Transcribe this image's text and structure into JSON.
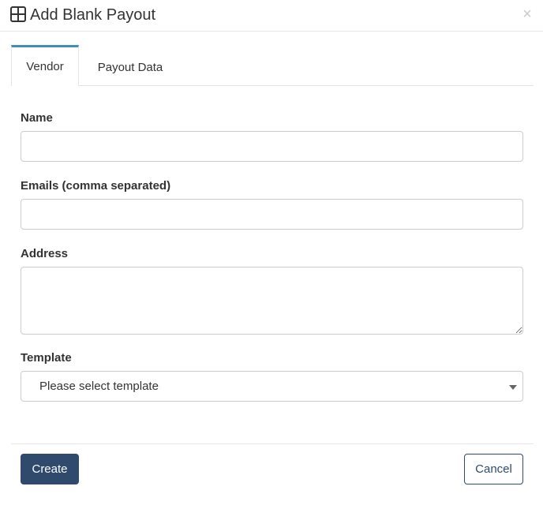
{
  "modal": {
    "title": "Add Blank Payout",
    "header_icon": "grid-icon",
    "close_glyph": "×"
  },
  "tabs": [
    {
      "label": "Vendor",
      "active": true
    },
    {
      "label": "Payout Data",
      "active": false
    }
  ],
  "form": {
    "name": {
      "label": "Name",
      "value": "",
      "placeholder": ""
    },
    "emails": {
      "label": "Emails (comma separated)",
      "value": "",
      "placeholder": ""
    },
    "address": {
      "label": "Address",
      "value": "",
      "placeholder": ""
    },
    "template": {
      "label": "Template",
      "selected": "Please select template"
    }
  },
  "footer": {
    "create_label": "Create",
    "cancel_label": "Cancel"
  },
  "colors": {
    "primary": "#2f4a6d",
    "tab_accent": "#3d8eb9",
    "border": "#cccccc"
  }
}
